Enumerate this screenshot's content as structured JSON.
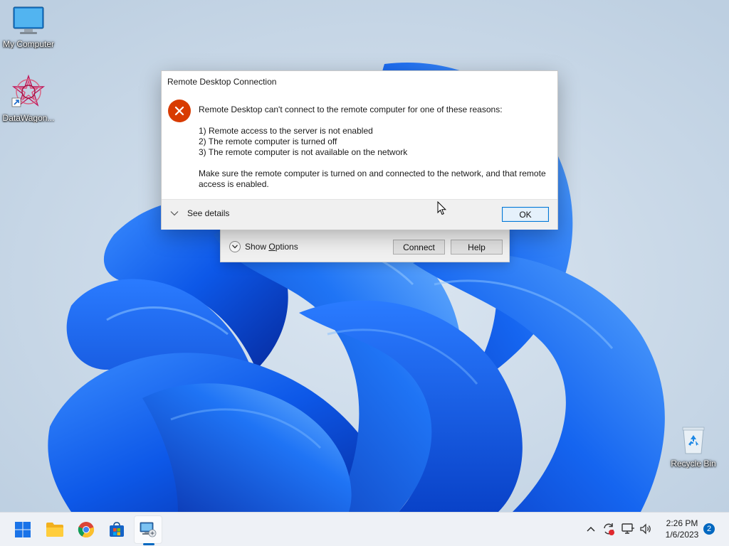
{
  "desktop": {
    "icons": {
      "my_computer": "My Computer",
      "datawagon": "DataWagon...",
      "recycle_bin": "Recycle Bin"
    }
  },
  "rdc_window": {
    "show_options_prefix": "Show ",
    "show_options_underlined": "O",
    "show_options_suffix": "ptions",
    "connect_label": "Connect",
    "help_label": "Help"
  },
  "error_dialog": {
    "title": "Remote Desktop Connection",
    "message_intro": "Remote Desktop can't connect to the remote computer for one of these reasons:",
    "reasons": [
      "1) Remote access to the server is not enabled",
      "2) The remote computer is turned off",
      "3) The remote computer is not available on the network"
    ],
    "message_outro": "Make sure the remote computer is turned on and connected to the network, and that remote access is enabled.",
    "see_details_label": "See details",
    "ok_label": "OK",
    "icon": "error-icon",
    "error_color": "#d83b01"
  },
  "taskbar": {
    "apps": [
      "windows-start-icon",
      "file-explorer-icon",
      "chrome-icon",
      "microsoft-store-icon",
      "remote-desktop-icon"
    ],
    "active_app": "remote-desktop-icon",
    "tray_icons": [
      "chevron-up-icon",
      "sync-icon",
      "network-icon",
      "volume-icon"
    ],
    "clock_time": "2:26 PM",
    "clock_date": "1/6/2023",
    "notification_count": "2",
    "accent_color": "#0067c0"
  }
}
